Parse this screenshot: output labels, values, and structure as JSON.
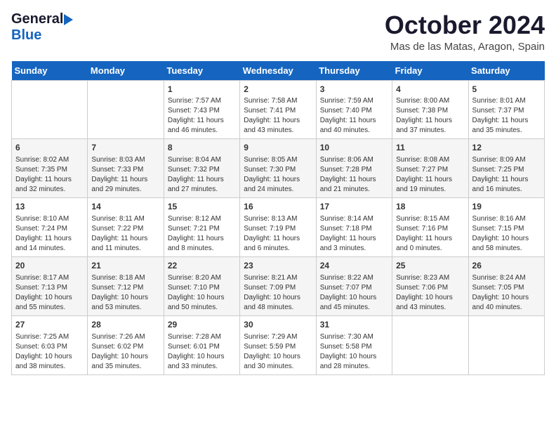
{
  "header": {
    "logo_general": "General",
    "logo_blue": "Blue",
    "month_title": "October 2024",
    "location": "Mas de las Matas, Aragon, Spain"
  },
  "calendar": {
    "days_of_week": [
      "Sunday",
      "Monday",
      "Tuesday",
      "Wednesday",
      "Thursday",
      "Friday",
      "Saturday"
    ],
    "weeks": [
      [
        {
          "day": "",
          "info": ""
        },
        {
          "day": "",
          "info": ""
        },
        {
          "day": "1",
          "info": "Sunrise: 7:57 AM\nSunset: 7:43 PM\nDaylight: 11 hours and 46 minutes."
        },
        {
          "day": "2",
          "info": "Sunrise: 7:58 AM\nSunset: 7:41 PM\nDaylight: 11 hours and 43 minutes."
        },
        {
          "day": "3",
          "info": "Sunrise: 7:59 AM\nSunset: 7:40 PM\nDaylight: 11 hours and 40 minutes."
        },
        {
          "day": "4",
          "info": "Sunrise: 8:00 AM\nSunset: 7:38 PM\nDaylight: 11 hours and 37 minutes."
        },
        {
          "day": "5",
          "info": "Sunrise: 8:01 AM\nSunset: 7:37 PM\nDaylight: 11 hours and 35 minutes."
        }
      ],
      [
        {
          "day": "6",
          "info": "Sunrise: 8:02 AM\nSunset: 7:35 PM\nDaylight: 11 hours and 32 minutes."
        },
        {
          "day": "7",
          "info": "Sunrise: 8:03 AM\nSunset: 7:33 PM\nDaylight: 11 hours and 29 minutes."
        },
        {
          "day": "8",
          "info": "Sunrise: 8:04 AM\nSunset: 7:32 PM\nDaylight: 11 hours and 27 minutes."
        },
        {
          "day": "9",
          "info": "Sunrise: 8:05 AM\nSunset: 7:30 PM\nDaylight: 11 hours and 24 minutes."
        },
        {
          "day": "10",
          "info": "Sunrise: 8:06 AM\nSunset: 7:28 PM\nDaylight: 11 hours and 21 minutes."
        },
        {
          "day": "11",
          "info": "Sunrise: 8:08 AM\nSunset: 7:27 PM\nDaylight: 11 hours and 19 minutes."
        },
        {
          "day": "12",
          "info": "Sunrise: 8:09 AM\nSunset: 7:25 PM\nDaylight: 11 hours and 16 minutes."
        }
      ],
      [
        {
          "day": "13",
          "info": "Sunrise: 8:10 AM\nSunset: 7:24 PM\nDaylight: 11 hours and 14 minutes."
        },
        {
          "day": "14",
          "info": "Sunrise: 8:11 AM\nSunset: 7:22 PM\nDaylight: 11 hours and 11 minutes."
        },
        {
          "day": "15",
          "info": "Sunrise: 8:12 AM\nSunset: 7:21 PM\nDaylight: 11 hours and 8 minutes."
        },
        {
          "day": "16",
          "info": "Sunrise: 8:13 AM\nSunset: 7:19 PM\nDaylight: 11 hours and 6 minutes."
        },
        {
          "day": "17",
          "info": "Sunrise: 8:14 AM\nSunset: 7:18 PM\nDaylight: 11 hours and 3 minutes."
        },
        {
          "day": "18",
          "info": "Sunrise: 8:15 AM\nSunset: 7:16 PM\nDaylight: 11 hours and 0 minutes."
        },
        {
          "day": "19",
          "info": "Sunrise: 8:16 AM\nSunset: 7:15 PM\nDaylight: 10 hours and 58 minutes."
        }
      ],
      [
        {
          "day": "20",
          "info": "Sunrise: 8:17 AM\nSunset: 7:13 PM\nDaylight: 10 hours and 55 minutes."
        },
        {
          "day": "21",
          "info": "Sunrise: 8:18 AM\nSunset: 7:12 PM\nDaylight: 10 hours and 53 minutes."
        },
        {
          "day": "22",
          "info": "Sunrise: 8:20 AM\nSunset: 7:10 PM\nDaylight: 10 hours and 50 minutes."
        },
        {
          "day": "23",
          "info": "Sunrise: 8:21 AM\nSunset: 7:09 PM\nDaylight: 10 hours and 48 minutes."
        },
        {
          "day": "24",
          "info": "Sunrise: 8:22 AM\nSunset: 7:07 PM\nDaylight: 10 hours and 45 minutes."
        },
        {
          "day": "25",
          "info": "Sunrise: 8:23 AM\nSunset: 7:06 PM\nDaylight: 10 hours and 43 minutes."
        },
        {
          "day": "26",
          "info": "Sunrise: 8:24 AM\nSunset: 7:05 PM\nDaylight: 10 hours and 40 minutes."
        }
      ],
      [
        {
          "day": "27",
          "info": "Sunrise: 7:25 AM\nSunset: 6:03 PM\nDaylight: 10 hours and 38 minutes."
        },
        {
          "day": "28",
          "info": "Sunrise: 7:26 AM\nSunset: 6:02 PM\nDaylight: 10 hours and 35 minutes."
        },
        {
          "day": "29",
          "info": "Sunrise: 7:28 AM\nSunset: 6:01 PM\nDaylight: 10 hours and 33 minutes."
        },
        {
          "day": "30",
          "info": "Sunrise: 7:29 AM\nSunset: 5:59 PM\nDaylight: 10 hours and 30 minutes."
        },
        {
          "day": "31",
          "info": "Sunrise: 7:30 AM\nSunset: 5:58 PM\nDaylight: 10 hours and 28 minutes."
        },
        {
          "day": "",
          "info": ""
        },
        {
          "day": "",
          "info": ""
        }
      ]
    ]
  }
}
